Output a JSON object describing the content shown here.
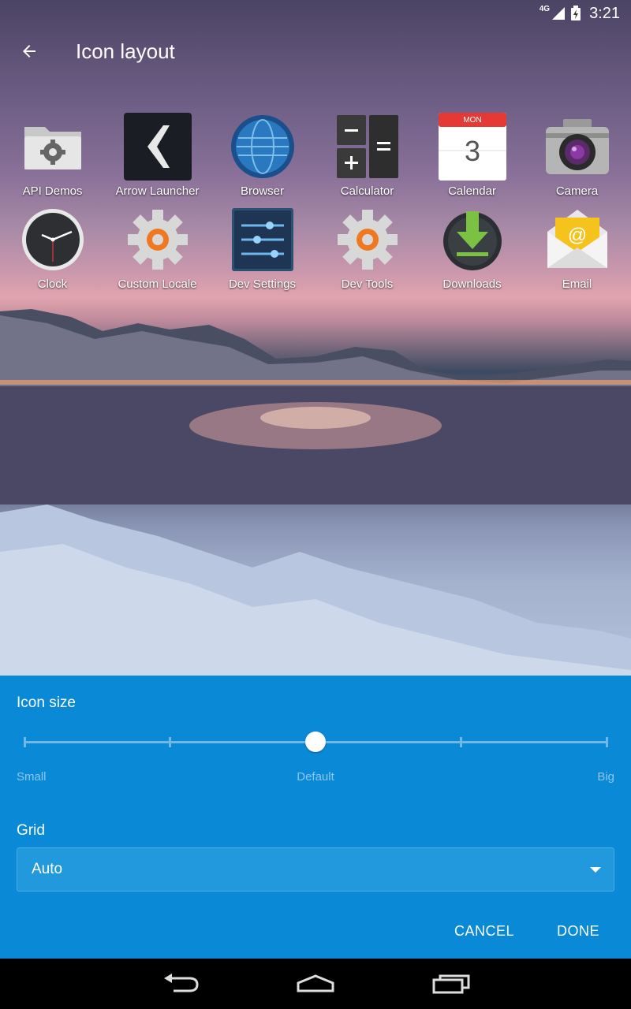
{
  "status_bar": {
    "network": "4G",
    "time": "3:21"
  },
  "app_bar": {
    "title": "Icon layout"
  },
  "apps": [
    {
      "label": "API Demos",
      "icon": "folder-gear-icon"
    },
    {
      "label": "Arrow Launcher",
      "icon": "arrow-launcher-icon"
    },
    {
      "label": "Browser",
      "icon": "globe-icon"
    },
    {
      "label": "Calculator",
      "icon": "calculator-icon"
    },
    {
      "label": "Calendar",
      "icon": "calendar-icon",
      "month": "MON",
      "day": "3"
    },
    {
      "label": "Camera",
      "icon": "camera-icon"
    },
    {
      "label": "Clock",
      "icon": "clock-icon"
    },
    {
      "label": "Custom Locale",
      "icon": "gear-icon"
    },
    {
      "label": "Dev Settings",
      "icon": "sliders-icon"
    },
    {
      "label": "Dev Tools",
      "icon": "gear-icon"
    },
    {
      "label": "Downloads",
      "icon": "download-icon"
    },
    {
      "label": "Email",
      "icon": "email-icon"
    }
  ],
  "icon_size": {
    "heading": "Icon size",
    "labels": {
      "small": "Small",
      "default": "Default",
      "big": "Big"
    },
    "steps": 5,
    "selected_step": 2
  },
  "grid": {
    "heading": "Grid",
    "value": "Auto"
  },
  "actions": {
    "cancel": "CANCEL",
    "done": "DONE"
  },
  "colors": {
    "panel": "#0a8ad6",
    "accent": "#72b8e6"
  }
}
